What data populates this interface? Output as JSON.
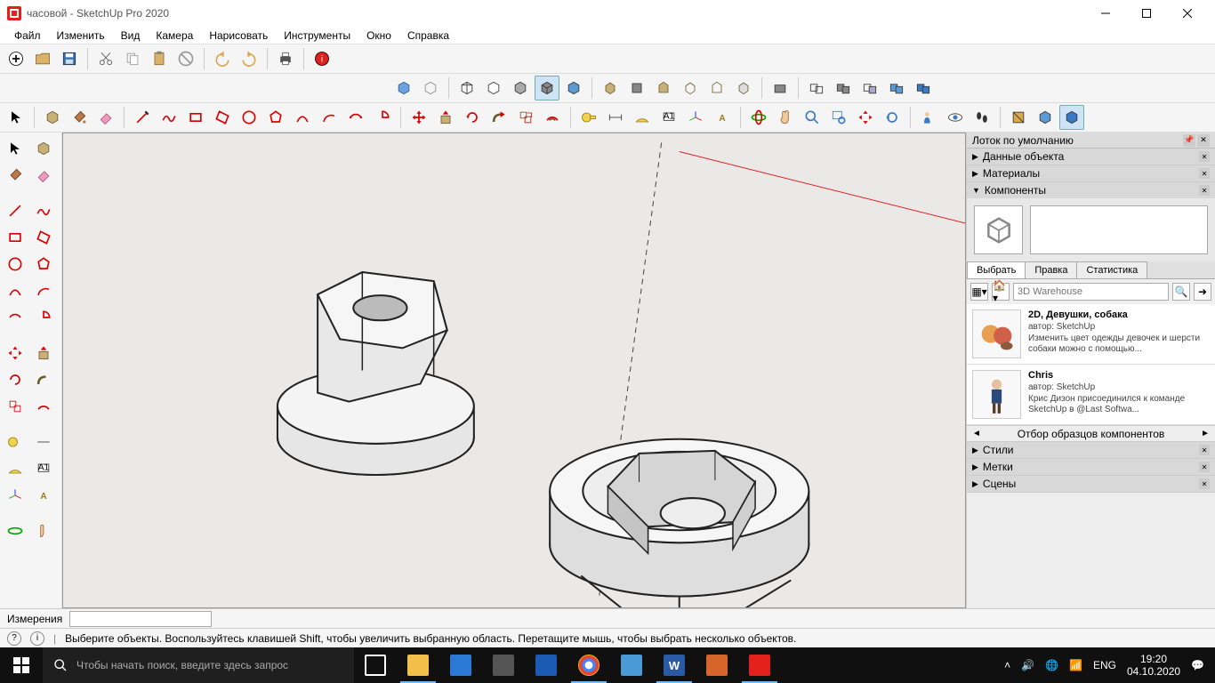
{
  "window": {
    "title": "часовой - SketchUp Pro 2020"
  },
  "menu": [
    "Файл",
    "Изменить",
    "Вид",
    "Камера",
    "Нарисовать",
    "Инструменты",
    "Окно",
    "Справка"
  ],
  "tray": {
    "header": "Лоток по умолчанию",
    "sections": {
      "entity_info": "Данные объекта",
      "materials": "Материалы",
      "components": "Компоненты",
      "styles": "Стили",
      "tags": "Метки",
      "scenes": "Сцены"
    },
    "tabs": {
      "select": "Выбрать",
      "edit": "Правка",
      "stats": "Статистика"
    },
    "search_placeholder": "3D Warehouse",
    "sample_label": "Отбор образцов компонентов",
    "items": [
      {
        "title": "2D, Девушки, собака",
        "author": "автор: SketchUp",
        "desc": "Изменить цвет одежды девочек и шерсти собаки можно с помощью..."
      },
      {
        "title": "Chris",
        "author": "автор: SketchUp",
        "desc": "Крис Дизон присоединился к команде SketchUp в @Last Softwa..."
      }
    ]
  },
  "measurements": {
    "label": "Измерения",
    "value": ""
  },
  "status": {
    "hint": "Выберите объекты. Воспользуйтесь клавишей Shift, чтобы увеличить выбранную область. Перетащите мышь, чтобы выбрать несколько объектов."
  },
  "taskbar": {
    "search_placeholder": "Чтобы начать поиск, введите здесь запрос",
    "lang": "ENG",
    "time": "19:20",
    "date": "04.10.2020"
  }
}
